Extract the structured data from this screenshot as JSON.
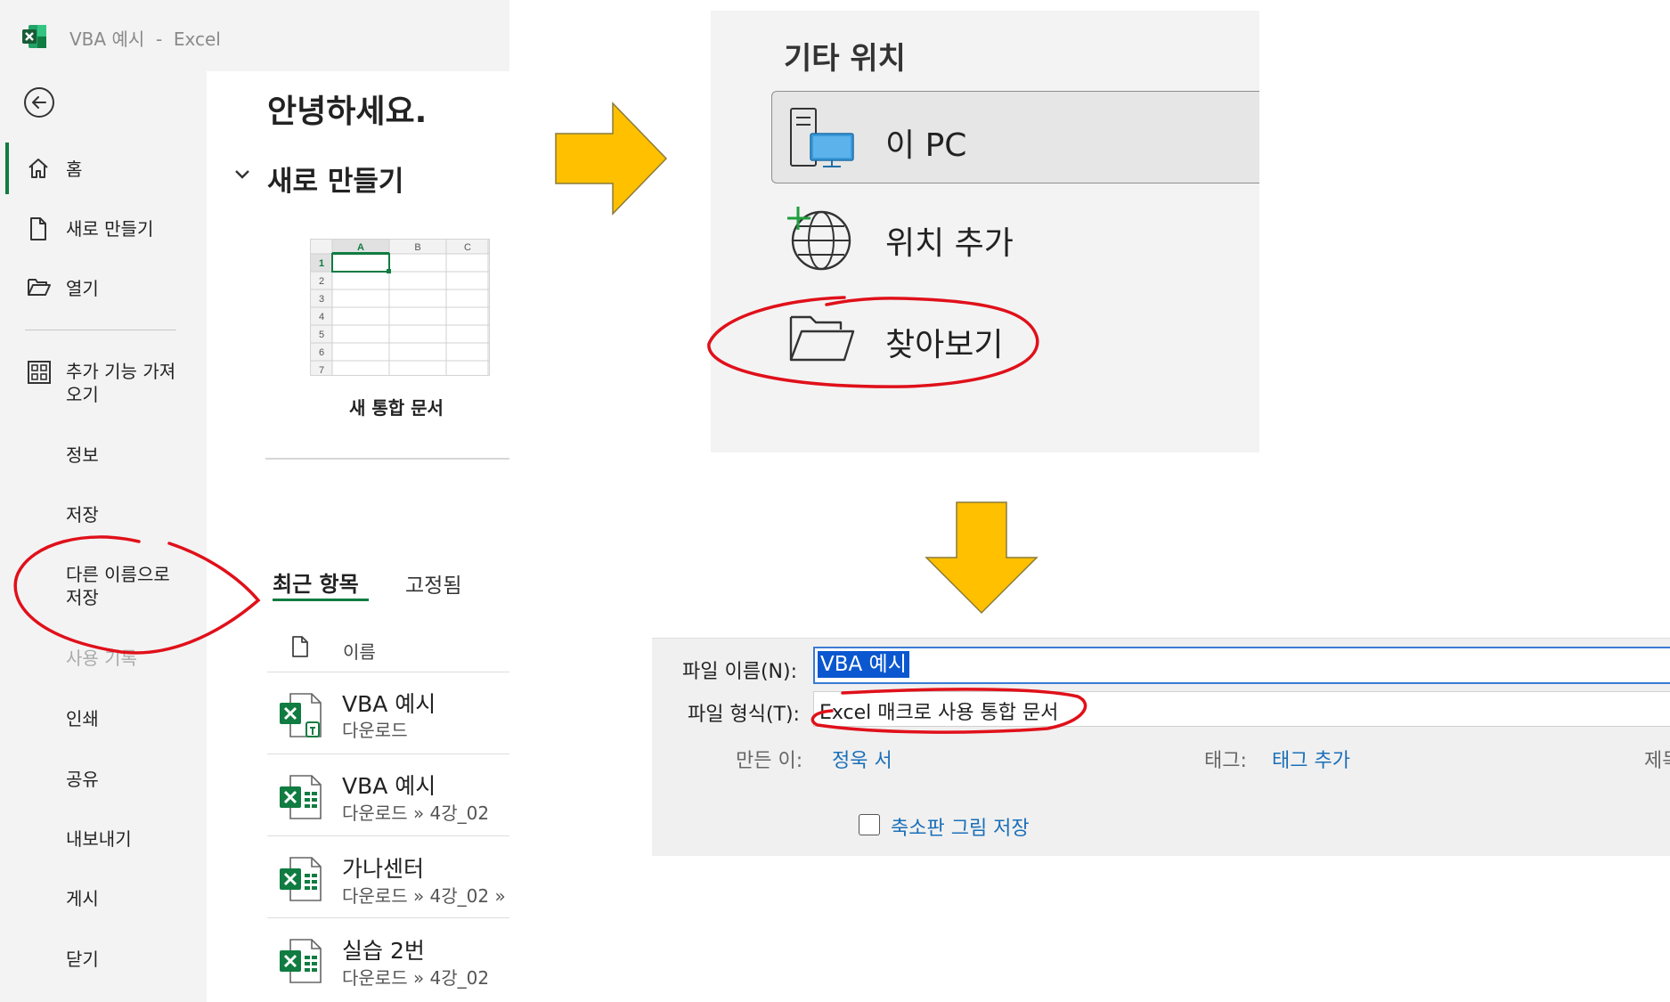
{
  "excel": {
    "window_title": "VBA 예시  -  Excel",
    "nav": {
      "home": "홈",
      "new": "새로 만들기",
      "open": "열기",
      "get_addins": "추가 기능 가져\n오기",
      "info": "정보",
      "save": "저장",
      "save_as": "다른 이름으로\n저장",
      "history": "사용 기록",
      "print": "인쇄",
      "share": "공유",
      "export": "내보내기",
      "publish": "게시",
      "close": "닫기"
    },
    "greeting": "안녕하세요.",
    "new_section": {
      "heading": "새로 만들기",
      "blank_workbook_label": "새 통합 문서",
      "grid_cols": [
        "A",
        "B",
        "C"
      ],
      "grid_rows": [
        "1",
        "2",
        "3",
        "4",
        "5",
        "6",
        "7"
      ]
    },
    "tabs": {
      "recent": "최근 항목",
      "pinned": "고정됨"
    },
    "list_header": {
      "name": "이름"
    },
    "recent_files": [
      {
        "name": "VBA 예시",
        "path": "다운로드"
      },
      {
        "name": "VBA 예시",
        "path": "다운로드 » 4강_02"
      },
      {
        "name": "가나센터",
        "path": "다운로드 » 4강_02 »"
      },
      {
        "name": "실습 2번",
        "path": "다운로드 » 4강_02"
      }
    ],
    "accent_color": "#107c41"
  },
  "locations": {
    "heading": "기타 위치",
    "this_pc": "이 PC",
    "add_location": "위치 추가",
    "browse": "찾아보기"
  },
  "save_dialog": {
    "filename_label": "파일 이름(N):",
    "filename_value": "VBA 예시",
    "filetype_label": "파일 형식(T):",
    "filetype_value": "Excel 매크로 사용 통합 문서",
    "author_label": "만든 이:",
    "author_value": "정욱 서",
    "tags_label": "태그:",
    "tags_value": "태그 추가",
    "title_label_partial": "제목",
    "save_thumbnail_label": "축소판 그림 저장"
  },
  "annotation": {
    "arrow_color": "#ffc000",
    "circle_color": "#e0101a"
  }
}
